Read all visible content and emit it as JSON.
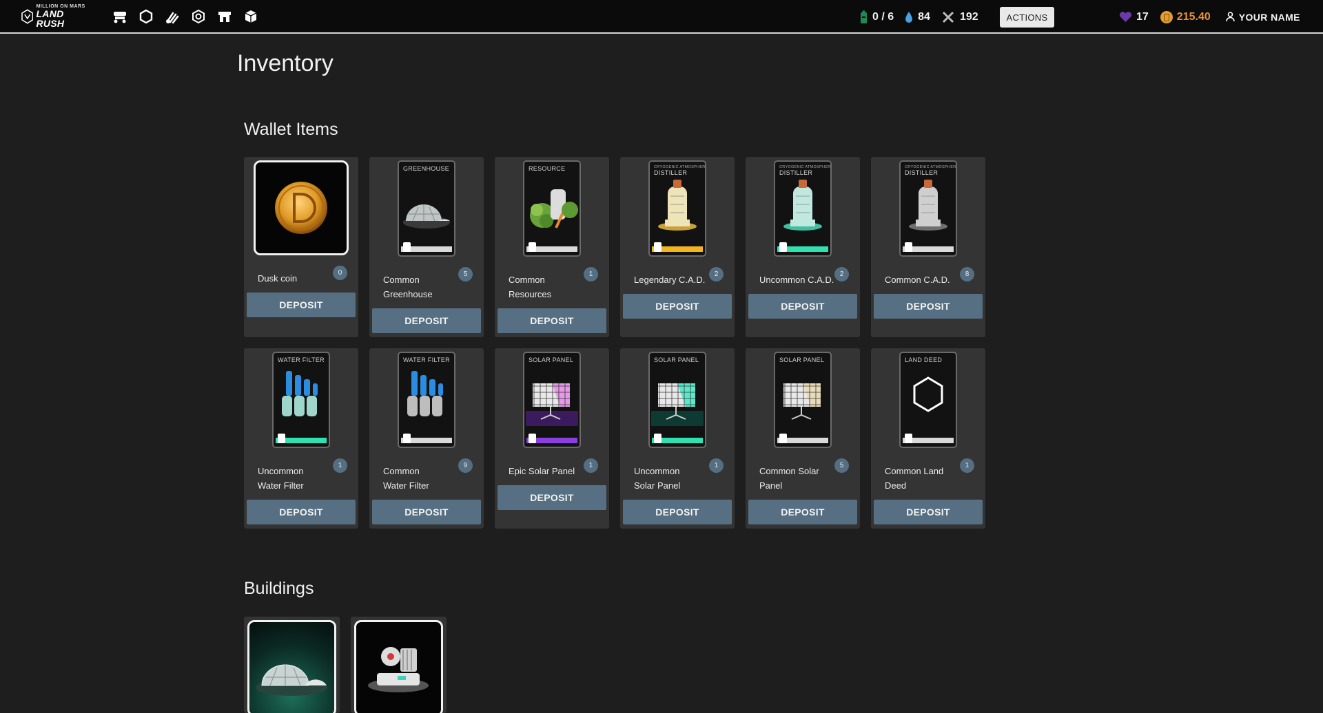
{
  "logo": {
    "line1": "MILLION ON MARS",
    "line2": "LAND RUSH"
  },
  "nav_icons": [
    "rover-icon",
    "hexagon-icon",
    "claw-icon",
    "gear-hex-icon",
    "store-icon",
    "cube-icon"
  ],
  "stats": {
    "energy": "0 / 6",
    "water": "84",
    "tools": "192",
    "actions_label": "ACTIONS",
    "gems": "17",
    "coins": "215.40",
    "user_name": "YOUR NAME"
  },
  "page": {
    "title": "Inventory"
  },
  "wallet": {
    "title": "Wallet Items",
    "deposit_label": "DEPOSIT",
    "items": [
      {
        "name": "Dusk coin",
        "count": "0",
        "kind": "coin",
        "rarity_color": ""
      },
      {
        "name": "Common Greenhouse",
        "count": "5",
        "kind": "greenhouse",
        "card_label": "GREENHOUSE",
        "rarity_color": "#d9d9d9"
      },
      {
        "name": "Common Resources",
        "count": "1",
        "kind": "resource",
        "card_label": "RESOURCE",
        "rarity_color": "#d9d9d9"
      },
      {
        "name": "Legendary C.A.D.",
        "count": "2",
        "kind": "distiller",
        "card_sub": "CRYOGENIC ATMOSPHERIC",
        "card_label": "DISTILLER",
        "rarity_color": "#f2b51c"
      },
      {
        "name": "Uncommon C.A.D.",
        "count": "2",
        "kind": "distiller",
        "card_sub": "CRYOGENIC ATMOSPHERIC",
        "card_label": "DISTILLER",
        "rarity_color": "#2fe0b0"
      },
      {
        "name": "Common C.A.D.",
        "count": "8",
        "kind": "distiller",
        "card_sub": "CRYOGENIC ATMOSPHERIC",
        "card_label": "DISTILLER",
        "rarity_color": "#d9d9d9"
      },
      {
        "name": "Uncommon Water Filter",
        "count": "1",
        "kind": "filter",
        "card_label": "WATER FILTER",
        "rarity_color": "#2fe0b0"
      },
      {
        "name": "Common Water Filter",
        "count": "9",
        "kind": "filter",
        "card_label": "WATER FILTER",
        "rarity_color": "#d9d9d9"
      },
      {
        "name": "Epic Solar Panel",
        "count": "1",
        "kind": "solar",
        "card_label": "SOLAR PANEL",
        "rarity_color": "#8a3fe0"
      },
      {
        "name": "Uncommon Solar Panel",
        "count": "1",
        "kind": "solar",
        "card_label": "SOLAR PANEL",
        "rarity_color": "#2fe0b0"
      },
      {
        "name": "Common Solar Panel",
        "count": "5",
        "kind": "solar",
        "card_label": "SOLAR PANEL",
        "rarity_color": "#d9d9d9"
      },
      {
        "name": "Common Land Deed",
        "count": "1",
        "kind": "deed",
        "card_label": "LAND DEED",
        "rarity_color": "#d9d9d9"
      }
    ]
  },
  "buildings": {
    "title": "Buildings",
    "items": [
      {
        "kind": "greenhouse"
      },
      {
        "kind": "distiller-machine"
      }
    ]
  },
  "colors": {
    "accent": "#566f82",
    "badge": "#556e82",
    "coin": "#e7913a",
    "background": "#1e1e1e",
    "card": "#343434"
  }
}
